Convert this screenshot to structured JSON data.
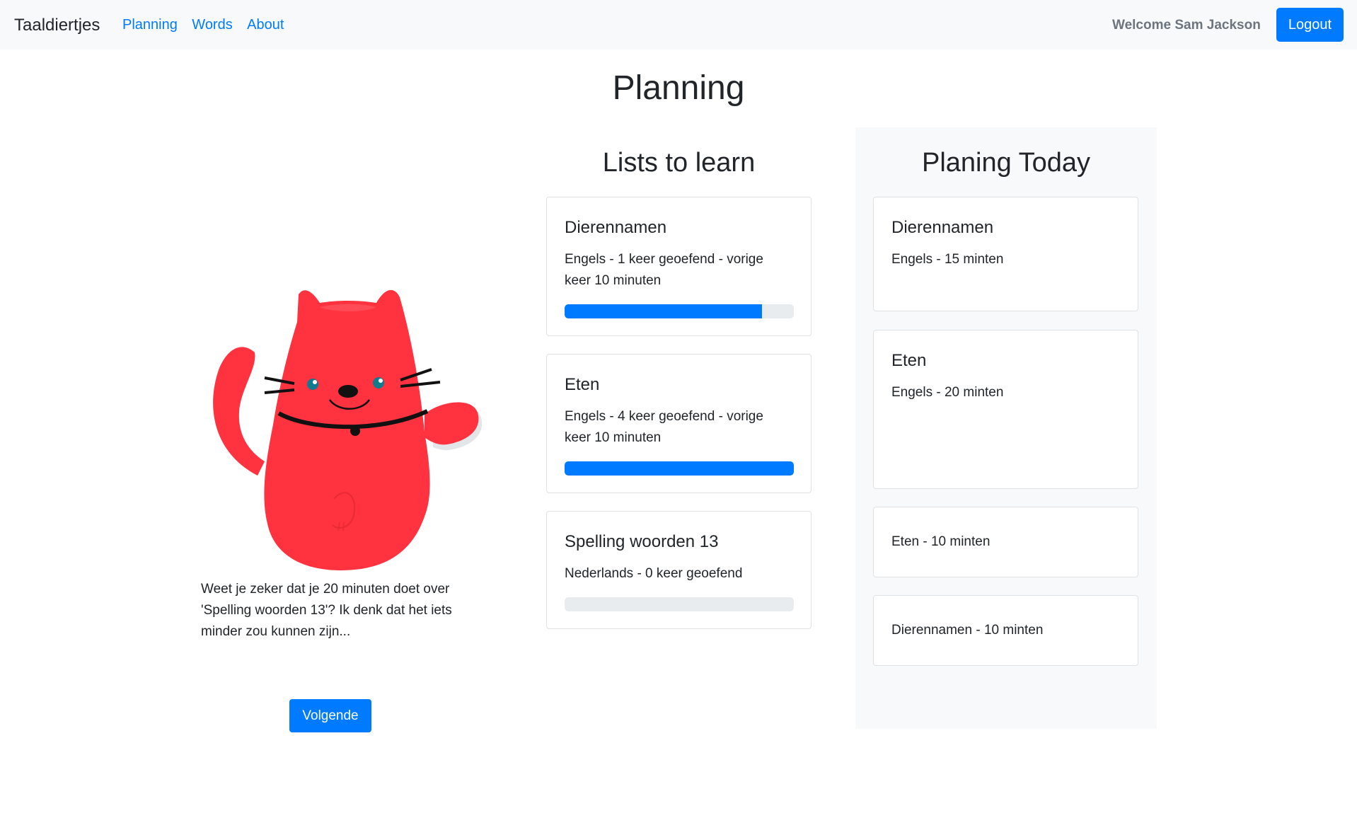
{
  "nav": {
    "brand": "Taaldiertjes",
    "links": [
      "Planning",
      "Words",
      "About"
    ],
    "welcome": "Welcome Sam Jackson",
    "logout": "Logout"
  },
  "page": {
    "title": "Planning"
  },
  "mascot": {
    "message": "Weet je zeker dat je 20 minuten doet over 'Spelling woorden 13'? Ik denk dat het iets minder zou kunnen zijn...",
    "next_button": "Volgende"
  },
  "lists_to_learn": {
    "heading": "Lists to learn",
    "cards": [
      {
        "title": "Dierennamen",
        "text": "Engels - 1 keer geoefend - vorige keer 10 minuten",
        "progress": 0.86
      },
      {
        "title": "Eten",
        "text": "Engels - 4 keer geoefend - vorige keer 10 minuten",
        "progress": 1.0
      },
      {
        "title": "Spelling woorden 13",
        "text": "Nederlands - 0 keer geoefend",
        "progress": 0.0
      }
    ]
  },
  "planning_today": {
    "heading": "Planing Today",
    "cards": [
      {
        "title": "Dierennamen",
        "text": "Engels - 15 minten"
      },
      {
        "title": "Eten",
        "text": "Engels - 20 minten"
      },
      {
        "text": "Eten - 10 minten"
      },
      {
        "text": "Dierennamen - 10 minten"
      }
    ]
  },
  "colors": {
    "primary": "#007bff",
    "cat": "#ff323f",
    "navbar_bg": "#f8f9fa"
  }
}
